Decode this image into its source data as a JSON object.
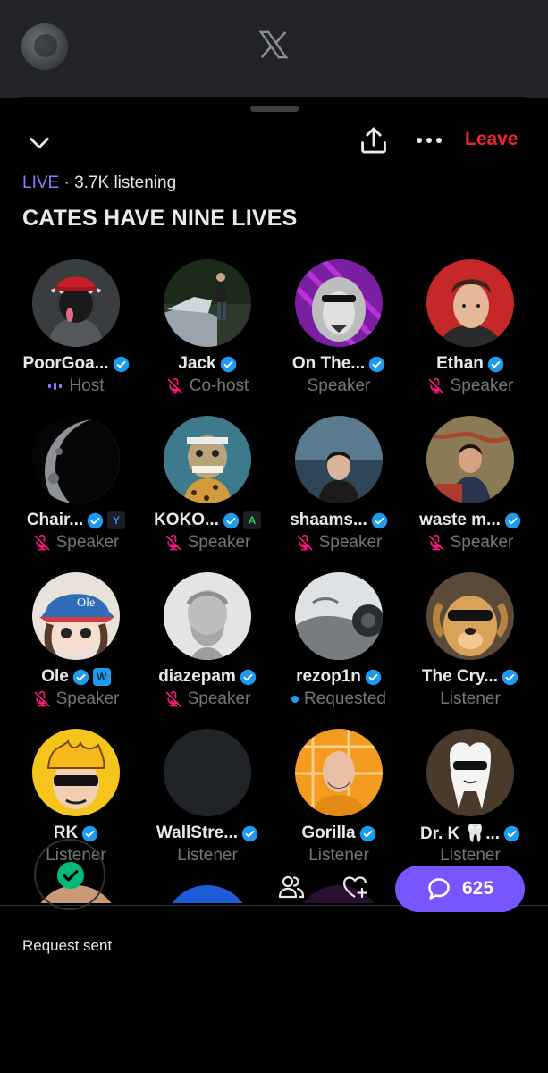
{
  "header": {
    "logo": "x-logo-icon"
  },
  "space": {
    "live_label": "LIVE",
    "listening": " · 3.7K listening",
    "title": "CATES HAVE NINE LIVES",
    "leave_label": "Leave"
  },
  "participants": [
    {
      "name": "PoorGoa...",
      "verified": true,
      "role": "Host"
    },
    {
      "name": "Jack",
      "verified": true,
      "role": "Co-host"
    },
    {
      "name": "On The...",
      "verified": true,
      "role": "Speaker"
    },
    {
      "name": "Ethan",
      "verified": true,
      "role": "Speaker"
    },
    {
      "name": "Chair...",
      "verified": true,
      "role": "Speaker",
      "badge": "Y"
    },
    {
      "name": "KOKO...",
      "verified": true,
      "role": "Speaker",
      "badge": "A"
    },
    {
      "name": "shaams...",
      "verified": true,
      "role": "Speaker"
    },
    {
      "name": "waste m...",
      "verified": true,
      "role": "Speaker"
    },
    {
      "name": "Ole",
      "verified": true,
      "role": "Speaker",
      "badge": "W"
    },
    {
      "name": "diazepam",
      "verified": true,
      "role": "Speaker"
    },
    {
      "name": "rezop1n",
      "verified": true,
      "role": "Requested"
    },
    {
      "name": "The Cry...",
      "verified": true,
      "role": "Listener"
    },
    {
      "name": "RK",
      "verified": true,
      "role": "Listener"
    },
    {
      "name": "WallStre...",
      "verified": true,
      "role": "Listener"
    },
    {
      "name": "Gorilla",
      "verified": true,
      "role": "Listener"
    },
    {
      "name": "Dr. K 🦷...",
      "verified": true,
      "role": "Listener"
    }
  ],
  "footer": {
    "request_label": "Request sent",
    "comment_count": "625"
  },
  "colors": {
    "accent": "#7856ff",
    "live": "#8c7cff",
    "leave": "#f4212e",
    "verified": "#1d9bf0",
    "muted_mic": "#f91880",
    "success": "#00ba7c"
  }
}
